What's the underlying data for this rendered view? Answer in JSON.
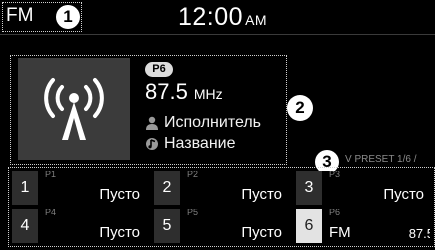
{
  "header": {
    "mode": "FM",
    "time": "12:00",
    "ampm": "AM"
  },
  "callouts": [
    "1",
    "2",
    "3"
  ],
  "station": {
    "preset_badge": "P6",
    "frequency": "87.5",
    "unit": "MHz",
    "artist": "Исполнитель",
    "title": "Название",
    "art_icon": "radio-broadcast-icon",
    "artist_icon": "person-icon",
    "title_icon": "music-note-icon"
  },
  "preset_list": {
    "caption": "V PRESET 1/6 /",
    "items": [
      {
        "number": "1",
        "tag": "P1",
        "name": "Пусто"
      },
      {
        "number": "2",
        "tag": "P2",
        "name": "Пусто"
      },
      {
        "number": "3",
        "tag": "P3",
        "name": "Пусто"
      },
      {
        "number": "4",
        "tag": "P4",
        "name": "Пусто"
      },
      {
        "number": "5",
        "tag": "P5",
        "name": "Пусто"
      },
      {
        "number": "6",
        "tag": "P6",
        "name": "FM",
        "freq": "87.5",
        "active": true
      }
    ]
  },
  "colors": {
    "background": "#000000",
    "tile": "#2e2e2e",
    "active_tile": "#e3e3e3",
    "art_bg": "#3b3b3b"
  }
}
